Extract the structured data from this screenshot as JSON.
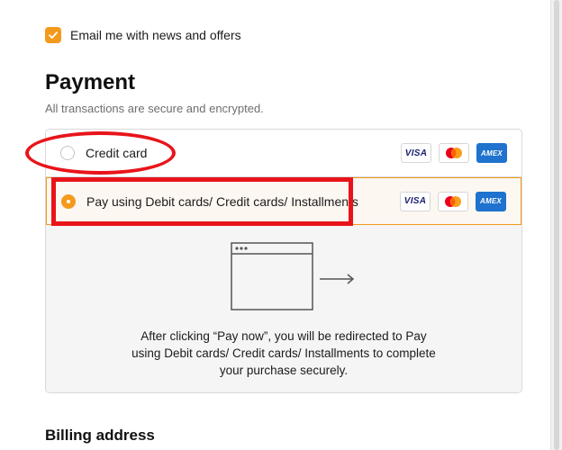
{
  "newsletter": {
    "label": "Email me with news and offers",
    "checked": true
  },
  "payment": {
    "title": "Payment",
    "subtitle": "All transactions are secure and encrypted.",
    "options": [
      {
        "label": "Credit card",
        "selected": false,
        "card_logos": [
          "VISA",
          "mastercard",
          "AMEX"
        ]
      },
      {
        "label": "Pay using Debit cards/ Credit cards/ Installments",
        "selected": true,
        "card_logos": [
          "VISA",
          "mastercard",
          "AMEX"
        ]
      }
    ],
    "redirect_message": "After clicking “Pay now”, you will be redirected to Pay using Debit cards/ Credit cards/ Installments to complete your purchase securely."
  },
  "billing": {
    "title": "Billing address"
  },
  "logos": {
    "visa_text": "VISA",
    "amex_text": "AMEX"
  },
  "colors": {
    "accent": "#f39a1d",
    "annotation": "#e8141a",
    "selected_option_bg": "#fdf7f1",
    "redirect_panel_bg": "#f5f5f5",
    "amex_blue": "#1f72cd",
    "visa_blue": "#1a1f71"
  }
}
